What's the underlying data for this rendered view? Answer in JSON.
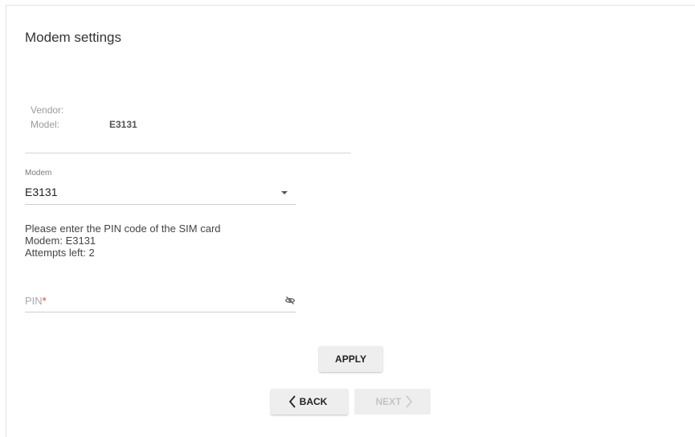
{
  "page": {
    "title": "Modem settings"
  },
  "info": {
    "vendor_label": "Vendor:",
    "vendor_value": "",
    "model_label": "Model:",
    "model_value": "E3131"
  },
  "modem_select": {
    "caption": "Modem",
    "value": "E3131"
  },
  "message": {
    "line1": "Please enter the PIN code of the SIM card",
    "line2": "Modem: E3131",
    "line3": "Attempts left: 2"
  },
  "pin": {
    "label": "PIN",
    "required_mark": "*",
    "value": "",
    "visibility_icon": "eye-off-icon"
  },
  "buttons": {
    "apply": "APPLY",
    "back": "BACK",
    "next": "NEXT",
    "back_icon": "chevron-left-icon",
    "next_icon": "chevron-right-icon"
  },
  "colors": {
    "required": "#e53935",
    "button_bg": "#eeeeee",
    "disabled_text": "#c4c4c4"
  }
}
